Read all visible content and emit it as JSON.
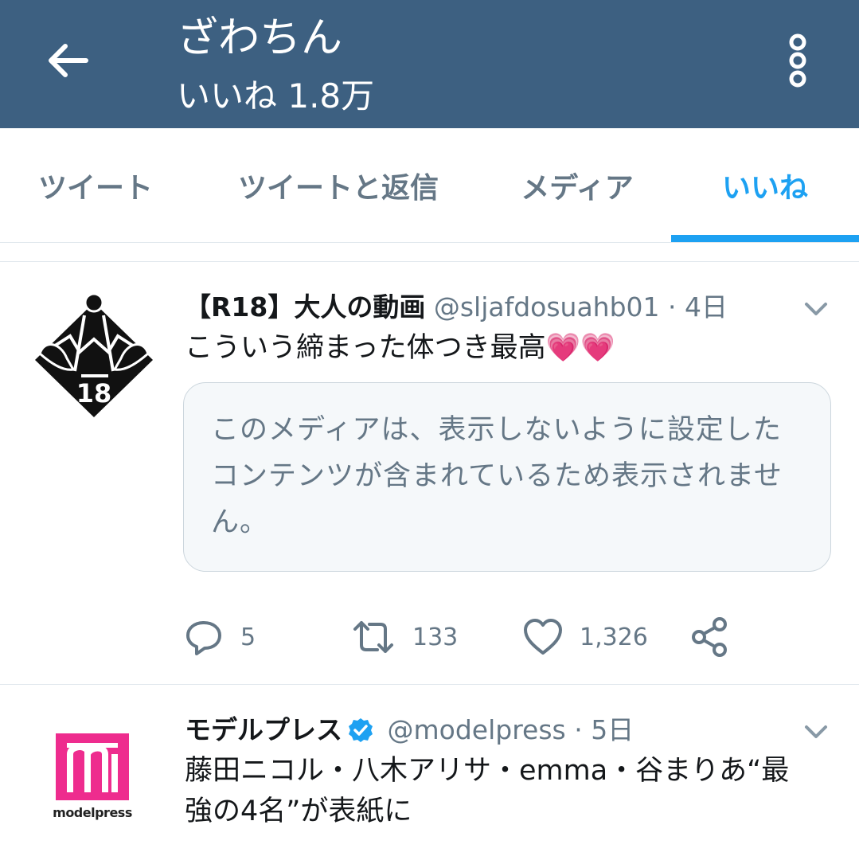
{
  "header": {
    "title": "ざわちん",
    "subtitle": "いいね 1.8万",
    "back_icon": "arrow-left-icon",
    "more_icon": "vertical-dots-icon",
    "bg_color": "#3d6081"
  },
  "tabs": [
    {
      "label": "ツイート",
      "active": false
    },
    {
      "label": "ツイートと返信",
      "active": false
    },
    {
      "label": "メディア",
      "active": false
    },
    {
      "label": "いいね",
      "active": true
    }
  ],
  "accent_color": "#1da1f2",
  "tweets": [
    {
      "author": "【R18】大人の動画",
      "handle": "@sljafdosuahb01",
      "separator": "·",
      "time": "4日",
      "text": "こういう締まった体つき最高💗💗",
      "media_notice": "このメディアは、表示しないように設定したコンテンツが含まれているため表示されません。",
      "avatar_icon": "r18-hands-logo-icon",
      "avatar_label": "18",
      "actions": {
        "reply": "5",
        "retweet": "133",
        "like": "1,326"
      }
    },
    {
      "author": "モデルプレス",
      "verified": true,
      "handle": "@modelpress",
      "separator": "·",
      "time": "5日",
      "text_line1": "藤田ニコル・八木アリサ・emma・谷まりあ“最",
      "text_line2": "強の4名”が表紙に",
      "avatar_icon": "modelpress-logo-icon",
      "avatar_label": "modelpress",
      "avatar_color": "#ee2c8e"
    }
  ]
}
